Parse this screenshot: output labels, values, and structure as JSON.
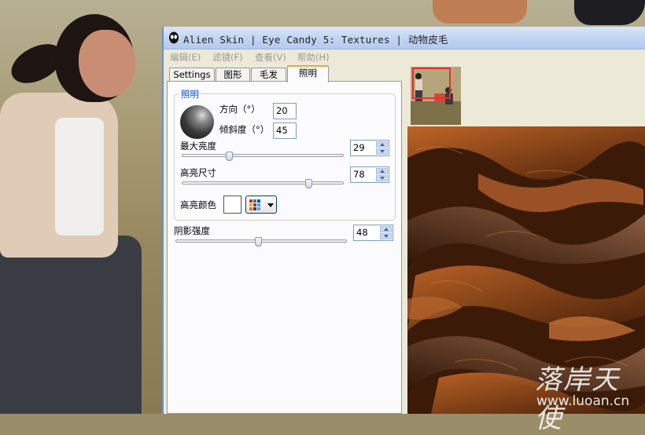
{
  "window": {
    "title": "Alien Skin | Eye Candy 5: Textures | 动物皮毛"
  },
  "menu": [
    {
      "label": "编辑(E)"
    },
    {
      "label": "滤镜(F)"
    },
    {
      "label": "查看(V)"
    },
    {
      "label": "帮助(H)"
    }
  ],
  "tabs": [
    {
      "label": "Settings"
    },
    {
      "label": "图形"
    },
    {
      "label": "毛发"
    },
    {
      "label": "照明",
      "active": true
    }
  ],
  "lighting": {
    "group_title": "照明",
    "direction_label": "方向（°）",
    "direction_value": "20",
    "inclination_label": "倾斜度（°）",
    "inclination_value": "45",
    "max_highlight_label": "最大亮度",
    "max_highlight_value": "29",
    "max_highlight_level": 29,
    "highlight_size_label": "高亮尺寸",
    "highlight_size_value": "78",
    "highlight_size_level": 78,
    "highlight_color_label": "高亮颜色",
    "highlight_color": "#ffffff"
  },
  "shadow": {
    "label": "阴影强度",
    "value": "48",
    "level": 48
  },
  "tools": [
    {
      "icon": "navigator-icon"
    },
    {
      "icon": "hand-icon"
    },
    {
      "icon": "magnifier-icon"
    }
  ],
  "watermark": {
    "text": "落岸天使",
    "url": "www.luoan.cn"
  },
  "colors": {
    "tab_accent": "#f2a537",
    "group_title": "#0046d5",
    "thumb_frame": "#e43030"
  }
}
